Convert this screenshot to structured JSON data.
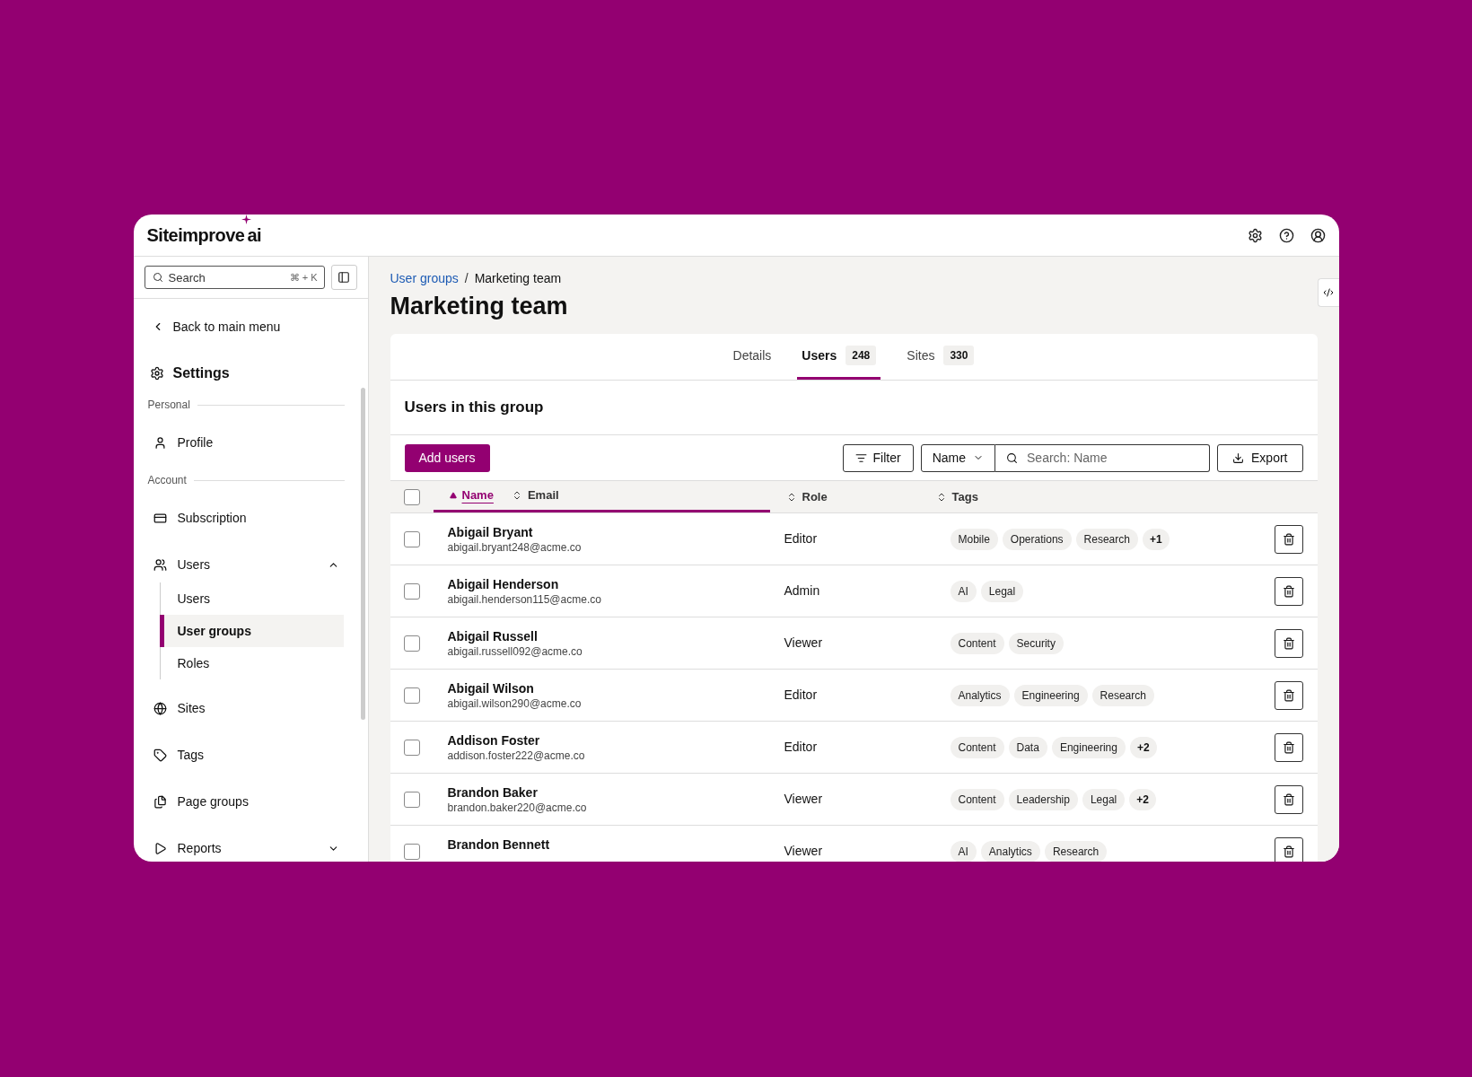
{
  "app": {
    "logo": "Siteimprove",
    "logo_suffix": "ai"
  },
  "sidebar": {
    "search": {
      "placeholder": "Search",
      "shortcut": "⌘ + K"
    },
    "back": "Back to main menu",
    "title": "Settings",
    "sections": [
      {
        "label": "Personal",
        "items": [
          {
            "label": "Profile",
            "selected": false
          }
        ]
      },
      {
        "label": "Account",
        "items": [
          {
            "label": "Subscription",
            "selected": false
          },
          {
            "label": "Users",
            "selected": false,
            "expanded": true,
            "children": [
              {
                "label": "Users",
                "selected": false
              },
              {
                "label": "User groups",
                "selected": true
              },
              {
                "label": "Roles",
                "selected": false
              }
            ]
          },
          {
            "label": "Sites",
            "selected": false
          },
          {
            "label": "Tags",
            "selected": false
          },
          {
            "label": "Page groups",
            "selected": false
          },
          {
            "label": "Reports",
            "selected": false,
            "expanded": false
          }
        ]
      }
    ]
  },
  "breadcrumb": {
    "separator": "/",
    "items": [
      {
        "label": "User groups"
      },
      {
        "label": "Marketing team"
      }
    ]
  },
  "title": "Marketing team",
  "tabs": [
    {
      "label": "Details",
      "selected": false
    },
    {
      "label": "Users",
      "count": "248",
      "selected": true
    },
    {
      "label": "Sites",
      "count": "330",
      "selected": false
    }
  ],
  "section_title": "Users in this group",
  "toolbar": {
    "add": "Add users",
    "filter": "Filter",
    "field": "Name",
    "search_placeholder": "Search: Name",
    "export": "Export"
  },
  "table": {
    "select_all_checked": false,
    "columns": [
      {
        "label": "Name",
        "selected": true
      },
      {
        "label": "Email",
        "selected": false
      },
      {
        "label": "Role",
        "selected": false
      },
      {
        "label": "Tags",
        "selected": false
      }
    ],
    "rows": [
      {
        "name": "Abigail Bryant",
        "email": "abigail.bryant248@acme.co",
        "role": "Editor",
        "tags": [
          "Mobile",
          "Operations",
          "Research"
        ],
        "more": "+1",
        "checked": false
      },
      {
        "name": "Abigail Henderson",
        "email": "abigail.henderson115@acme.co",
        "role": "Admin",
        "tags": [
          "AI",
          "Legal"
        ],
        "checked": false
      },
      {
        "name": "Abigail Russell",
        "email": "abigail.russell092@acme.co",
        "role": "Viewer",
        "tags": [
          "Content",
          "Security"
        ],
        "checked": false
      },
      {
        "name": "Abigail Wilson",
        "email": "abigail.wilson290@acme.co",
        "role": "Editor",
        "tags": [
          "Analytics",
          "Engineering",
          "Research"
        ],
        "checked": false
      },
      {
        "name": "Addison Foster",
        "email": "addison.foster222@acme.co",
        "role": "Editor",
        "tags": [
          "Content",
          "Data",
          "Engineering"
        ],
        "more": "+2",
        "checked": false
      },
      {
        "name": "Brandon Baker",
        "email": "brandon.baker220@acme.co",
        "role": "Viewer",
        "tags": [
          "Content",
          "Leadership",
          "Legal"
        ],
        "more": "+2",
        "checked": false
      },
      {
        "name": "Brandon Bennett",
        "role": "Viewer",
        "tags": [
          "AI",
          "Analytics",
          "Research"
        ],
        "checked": false
      }
    ]
  }
}
